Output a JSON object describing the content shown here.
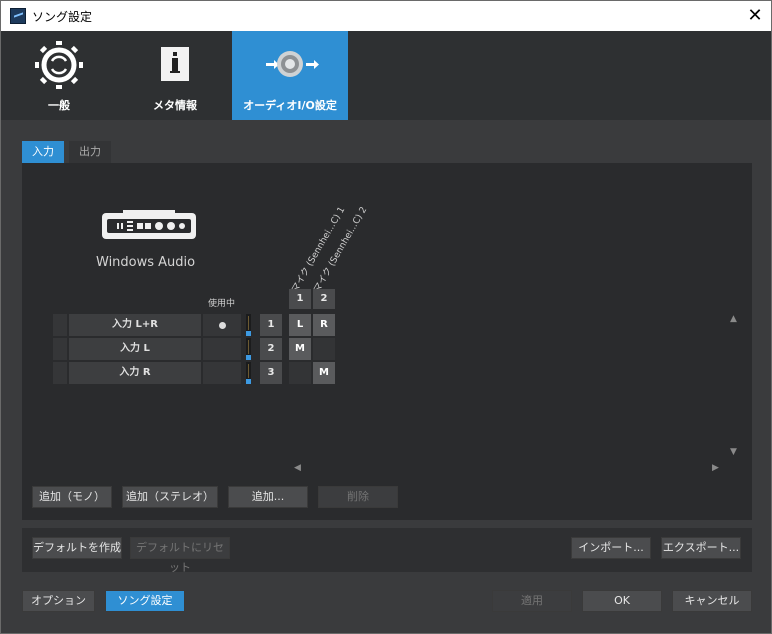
{
  "window": {
    "title": "ソング設定",
    "close_glyph": "✕"
  },
  "main_tabs": [
    {
      "label": "一般",
      "icon": "gear-cycle-icon"
    },
    {
      "label": "メタ情報",
      "icon": "info-document-icon"
    },
    {
      "label": "オーディオI/O設定",
      "icon": "audio-io-icon",
      "active": true
    }
  ],
  "sub_tabs": [
    {
      "label": "入力",
      "active": true
    },
    {
      "label": "出力",
      "active": false
    }
  ],
  "device": {
    "name": "Windows Audio",
    "icon": "audio-interface-icon"
  },
  "matrix": {
    "in_use_header": "使用中",
    "column_labels": [
      "マイク (Sennhei...C) 1",
      "マイク (Sennhei...C) 2"
    ],
    "column_numbers": [
      "1",
      "2"
    ],
    "rows": [
      {
        "label": "入力 L+R",
        "in_use": true,
        "number": "1",
        "cells": [
          "L",
          "R"
        ],
        "meter_level": 0.2
      },
      {
        "label": "入力 L",
        "in_use": false,
        "number": "2",
        "cells": [
          "M",
          ""
        ],
        "meter_level": 0.2
      },
      {
        "label": "入力 R",
        "in_use": false,
        "number": "3",
        "cells": [
          "",
          "M"
        ],
        "meter_level": 0.2
      }
    ]
  },
  "scroll": {
    "up": "▲",
    "down": "▼",
    "left": "◀",
    "right": "▶"
  },
  "panel_buttons": {
    "add_mono": "追加（モノ）",
    "add_stereo": "追加（ステレオ）",
    "add": "追加...",
    "delete": "削除"
  },
  "preset_buttons": {
    "make_default": "デフォルトを作成",
    "reset_default": "デフォルトにリセット",
    "import": "インポート...",
    "export": "エクスポート..."
  },
  "footer_buttons": {
    "options": "オプション",
    "song_settings": "ソング設定",
    "apply": "適用",
    "ok": "OK",
    "cancel": "キャンセル"
  },
  "colors": {
    "accent": "#2f8fd3",
    "background": "#3a3b3d",
    "panel": "#2a2b2d"
  }
}
